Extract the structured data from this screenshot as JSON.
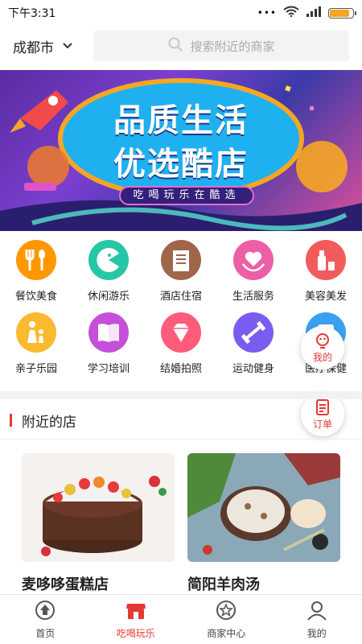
{
  "status": {
    "time": "下午3:31",
    "dots": "•••",
    "battery_level": 0.85,
    "battery_color": "#f5a623"
  },
  "header": {
    "city": "成都市",
    "search_placeholder": "搜索附近的商家"
  },
  "banner": {
    "line1": "品质生活",
    "line2": "优选酷店",
    "tagline": "吃喝玩乐在酷选"
  },
  "categories": [
    {
      "label": "餐饮美食",
      "icon": "fork-spoon-icon",
      "color": "#ff9800"
    },
    {
      "label": "休闲游乐",
      "icon": "pacman-icon",
      "color": "#26c6a6"
    },
    {
      "label": "酒店住宿",
      "icon": "hotel-icon",
      "color": "#a0664a"
    },
    {
      "label": "生活服务",
      "icon": "heart-hands-icon",
      "color": "#ec5fa6"
    },
    {
      "label": "美容美发",
      "icon": "cosmetics-icon",
      "color": "#f25b5b"
    },
    {
      "label": "亲子乐园",
      "icon": "parent-child-icon",
      "color": "#fbb92f"
    },
    {
      "label": "学习培训",
      "icon": "book-icon",
      "color": "#c54fd8"
    },
    {
      "label": "结婚拍照",
      "icon": "diamond-icon",
      "color": "#ff5b7a"
    },
    {
      "label": "运动健身",
      "icon": "dumbbell-icon",
      "color": "#7a5cf0"
    },
    {
      "label": "医疗保健",
      "icon": "medical-icon",
      "color": "#3aa0f0"
    }
  ],
  "floating": {
    "mine": "我的",
    "orders": "订单"
  },
  "section": {
    "title": "附近的店"
  },
  "shops": [
    {
      "name": "麦哆哆蛋糕店"
    },
    {
      "name": "简阳羊肉汤"
    }
  ],
  "tabs": [
    {
      "label": "首页",
      "icon": "home-icon"
    },
    {
      "label": "吃喝玩乐",
      "icon": "store-icon",
      "active": true
    },
    {
      "label": "商家中心",
      "icon": "star-icon"
    },
    {
      "label": "我的",
      "icon": "user-icon"
    }
  ],
  "colors": {
    "accent": "#e53935"
  }
}
